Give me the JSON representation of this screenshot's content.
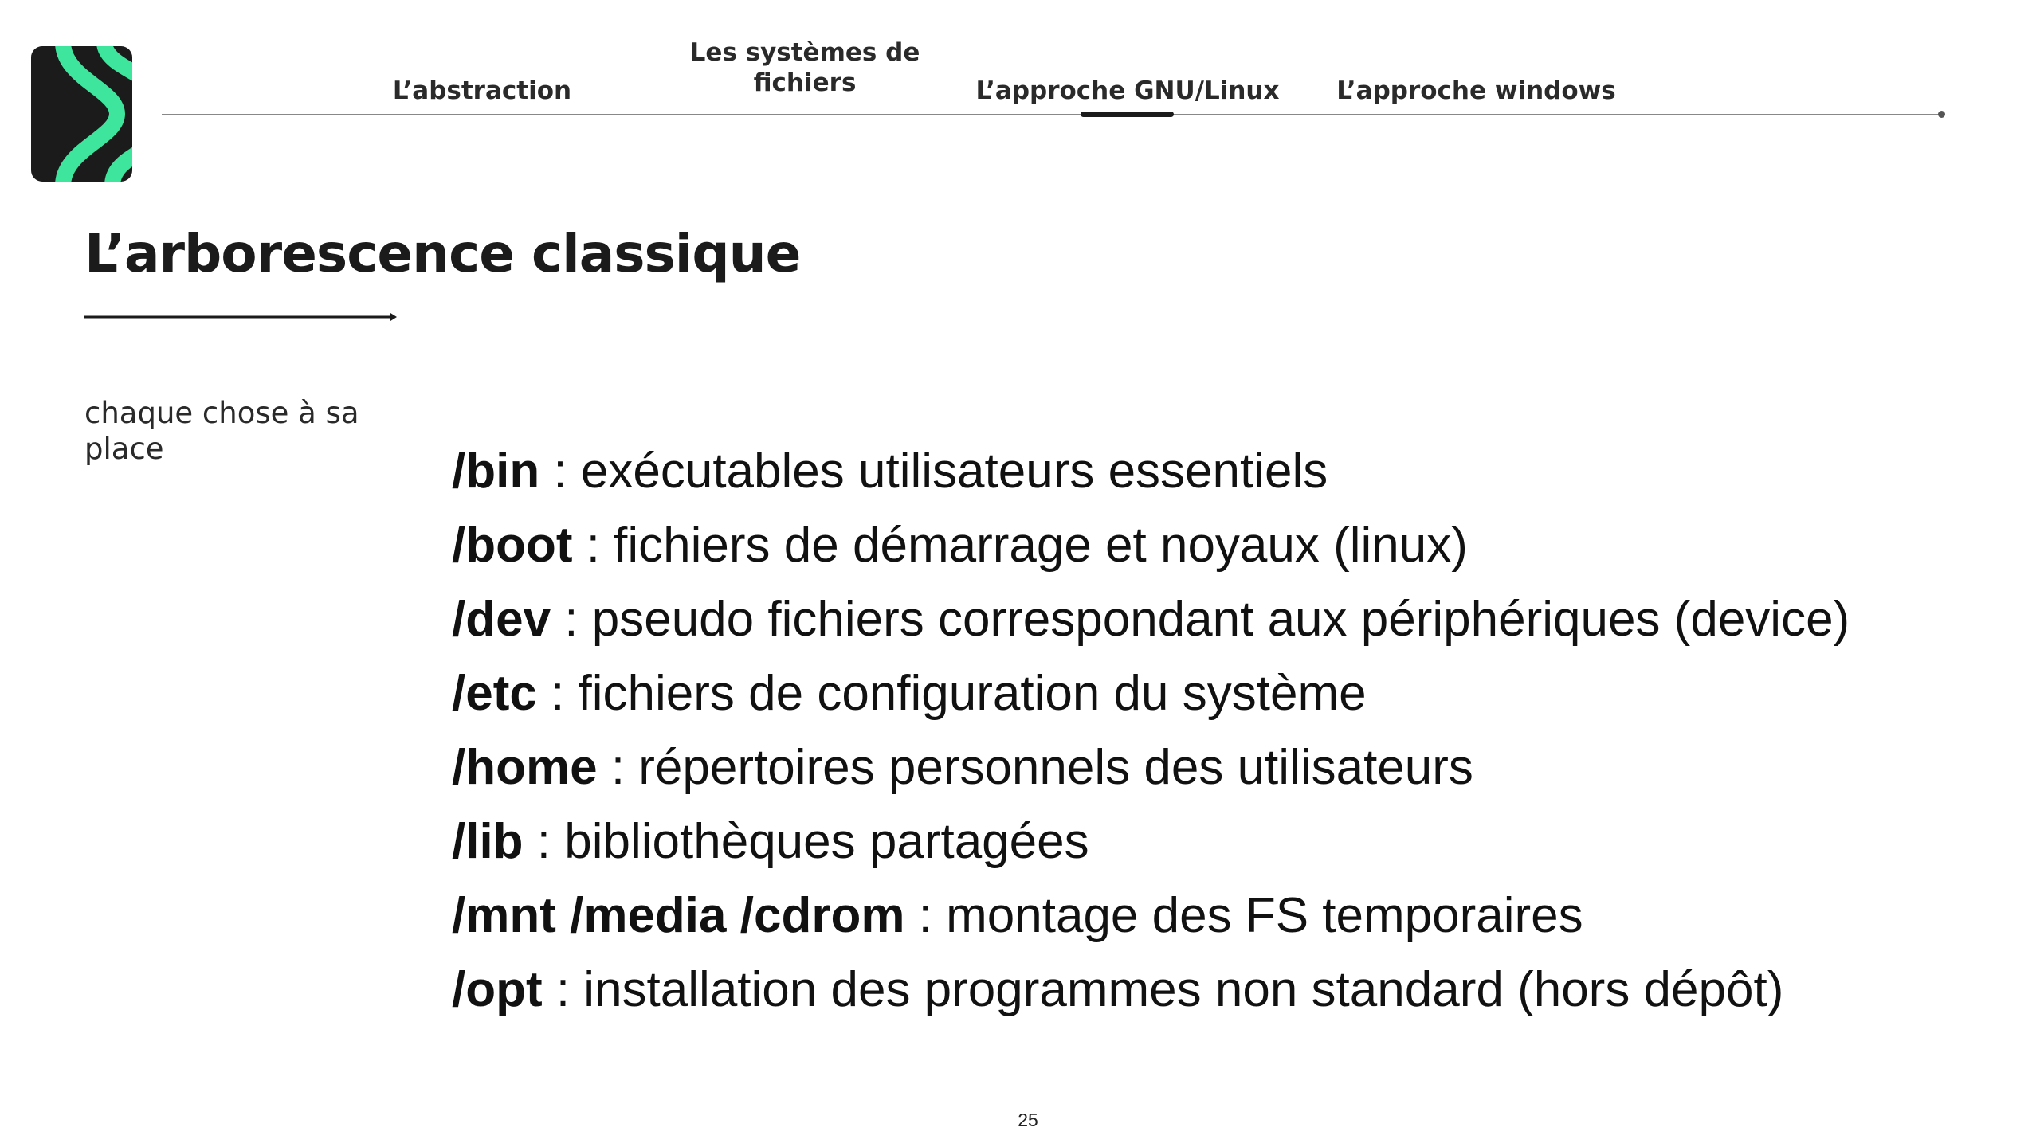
{
  "logo": {
    "icon": "brand-logo-icon",
    "colors": {
      "background": "#1b1b1b",
      "accent": "#3ee59c"
    }
  },
  "nav": {
    "items": [
      {
        "label": "L’abstraction"
      },
      {
        "label": "Les systèmes de fichiers"
      },
      {
        "label": "L’approche GNU/Linux",
        "active": true
      },
      {
        "label": "L’approche windows"
      }
    ]
  },
  "slide": {
    "title": "L’arborescence classique",
    "side_note": "chaque chose à sa place",
    "directories": [
      {
        "path": "/bin",
        "description": " : exécutables utilisateurs essentiels"
      },
      {
        "path": "/boot",
        "description": " : fichiers de démarrage et noyaux (linux)"
      },
      {
        "path": "/dev",
        "description": " : pseudo fichiers correspondant aux périphériques (device)"
      },
      {
        "path": "/etc",
        "description": " : fichiers de configuration du système"
      },
      {
        "path": "/home",
        "description": " : répertoires personnels des utilisateurs"
      },
      {
        "path": "/lib",
        "description": " : bibliothèques partagées"
      },
      {
        "path": "/mnt /media /cdrom",
        "description": " : montage des FS temporaires"
      },
      {
        "path": "/opt",
        "description": " : installation des programmes non standard (hors dépôt)"
      }
    ],
    "page_number": "25"
  }
}
